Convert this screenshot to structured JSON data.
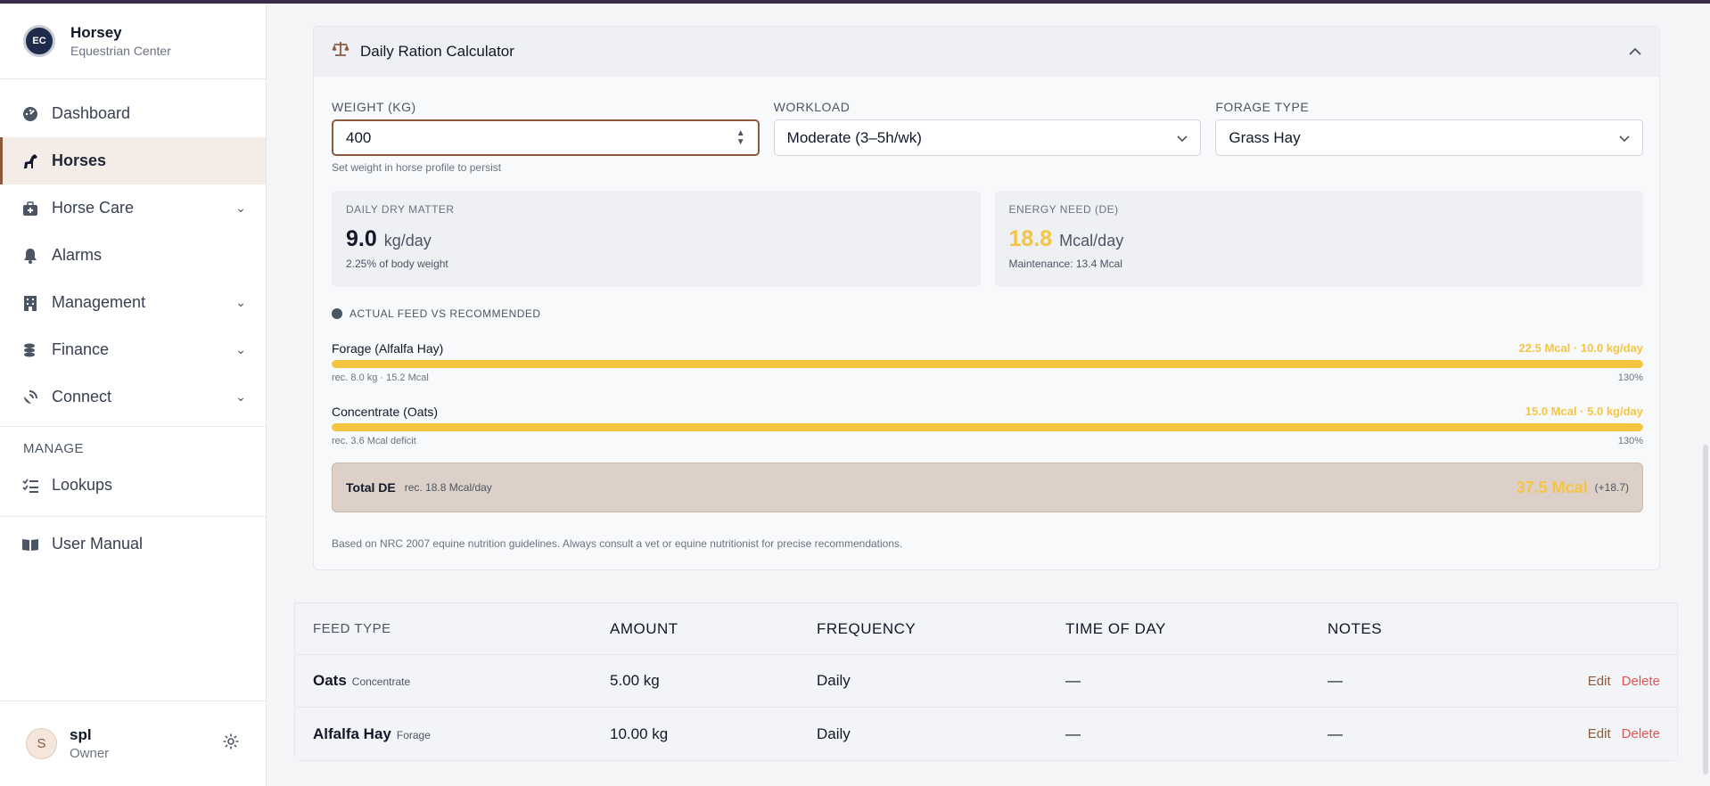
{
  "brand": {
    "name": "Horsey",
    "subtitle": "Equestrian Center",
    "logo_text": "EC"
  },
  "nav": {
    "dashboard": "Dashboard",
    "horses": "Horses",
    "horse_care": "Horse Care",
    "alarms": "Alarms",
    "management": "Management",
    "finance": "Finance",
    "connect": "Connect",
    "section_manage": "MANAGE",
    "lookups": "Lookups",
    "user_manual": "User Manual"
  },
  "user": {
    "initial": "S",
    "name": "spl",
    "role": "Owner"
  },
  "calculator": {
    "title": "Daily Ration Calculator",
    "weight_label": "WEIGHT (KG)",
    "weight_value": "400",
    "weight_hint": "Set weight in horse profile to persist",
    "workload_label": "WORKLOAD",
    "workload_value": "Moderate (3–5h/wk)",
    "forage_label": "FORAGE TYPE",
    "forage_value": "Grass Hay",
    "dry_matter": {
      "label": "DAILY DRY MATTER",
      "value": "9.0",
      "unit": "kg/day",
      "sub": "2.25% of body weight"
    },
    "energy": {
      "label": "ENERGY NEED (DE)",
      "value": "18.8",
      "unit": "Mcal/day",
      "sub": "Maintenance: 13.4 Mcal"
    },
    "comparison_title": "ACTUAL FEED VS RECOMMENDED",
    "bars": [
      {
        "name": "Forage (Alfalfa Hay)",
        "value_text": "22.5 Mcal · 10.0 kg/day",
        "rec": "rec. 8.0 kg · 15.2 Mcal",
        "percent_text": "130%",
        "fill": 1.0
      },
      {
        "name": "Concentrate (Oats)",
        "value_text": "15.0 Mcal · 5.0 kg/day",
        "rec": "rec. 3.6 Mcal deficit",
        "percent_text": "130%",
        "fill": 1.0
      }
    ],
    "total": {
      "label": "Total DE",
      "rec": "rec. 18.8 Mcal/day",
      "value": "37.5 Mcal",
      "diff": "(+18.7)"
    },
    "disclaimer": "Based on NRC 2007 equine nutrition guidelines. Always consult a vet or equine nutritionist for precise recommendations."
  },
  "table": {
    "headers": {
      "feed_type": "FEED TYPE",
      "amount": "AMOUNT",
      "frequency": "FREQUENCY",
      "time_of_day": "TIME OF DAY",
      "notes": "NOTES"
    },
    "rows": [
      {
        "name": "Oats",
        "category": "Concentrate",
        "amount": "5.00 kg",
        "frequency": "Daily",
        "time": "—",
        "notes": "—",
        "edit": "Edit",
        "delete": "Delete"
      },
      {
        "name": "Alfalfa Hay",
        "category": "Forage",
        "amount": "10.00 kg",
        "frequency": "Daily",
        "time": "—",
        "notes": "—",
        "edit": "Edit",
        "delete": "Delete"
      }
    ]
  },
  "colors": {
    "accent": "#8a5a3b",
    "gold": "#f5c542",
    "delete": "#e25555"
  }
}
